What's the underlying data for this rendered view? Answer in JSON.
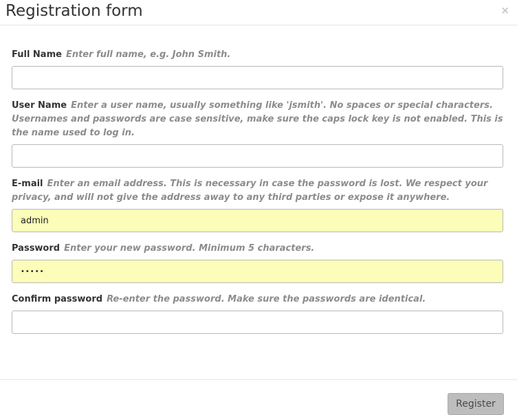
{
  "dialog": {
    "title": "Registration form",
    "close_label": "×"
  },
  "fields": {
    "full_name": {
      "label": "Full Name",
      "hint": "Enter full name, e.g. John Smith.",
      "value": ""
    },
    "user_name": {
      "label": "User Name",
      "hint": "Enter a user name, usually something like 'jsmith'. No spaces or special characters. Usernames and passwords are case sensitive, make sure the caps lock key is not enabled. This is the name used to log in.",
      "value": ""
    },
    "email": {
      "label": "E-mail",
      "hint": "Enter an email address. This is necessary in case the password is lost. We respect your privacy, and will not give the address away to any third parties or expose it anywhere.",
      "value": "admin"
    },
    "password": {
      "label": "Password",
      "hint": "Enter your new password. Minimum 5 characters.",
      "value": "•••••"
    },
    "confirm_password": {
      "label": "Confirm password",
      "hint": "Re-enter the password. Make sure the passwords are identical.",
      "value": ""
    }
  },
  "footer": {
    "register_label": "Register"
  },
  "colors": {
    "autofill_background": "#fbfdb8",
    "hint_text": "#8c8c8c",
    "button_background": "#bdbdbd"
  }
}
